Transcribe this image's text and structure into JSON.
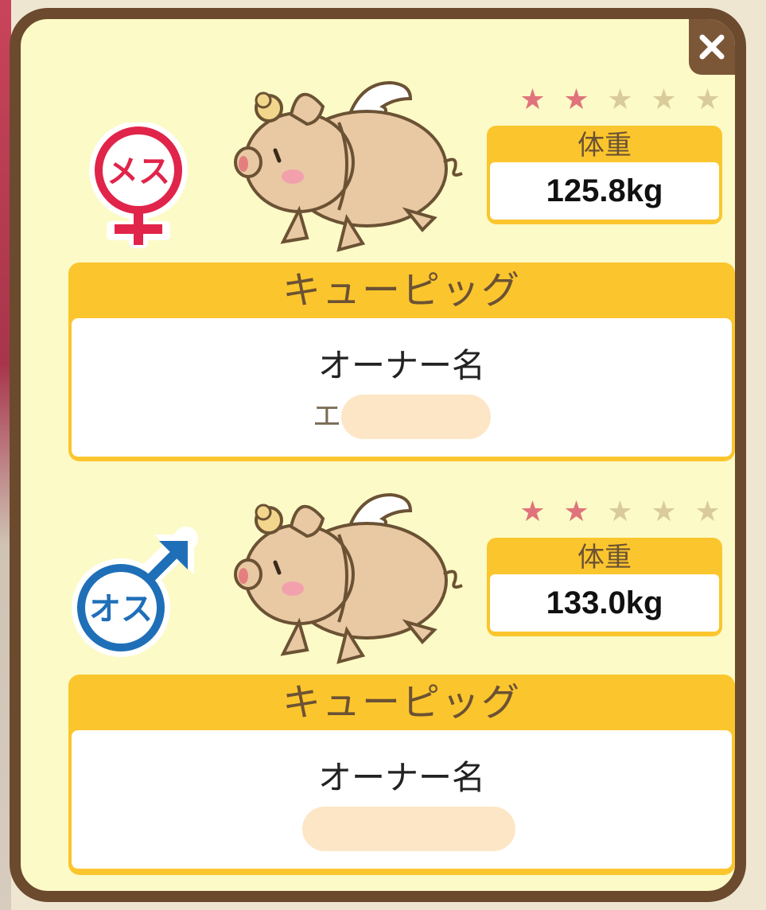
{
  "dialog": {
    "close_icon": "close-x-icon"
  },
  "pigs": [
    {
      "gender_label": "メス",
      "gender_icon": "female-symbol-icon",
      "gender_color": "#e1244a",
      "rating": 2,
      "rating_max": 5,
      "star_filled_color": "#e0737b",
      "star_empty_color": "#d9cb9a",
      "weight_label": "体重",
      "weight_value": "125.8kg",
      "breed_name": "キューピッグ",
      "owner_label": "オーナー名",
      "owner_name_visible": "エ"
    },
    {
      "gender_label": "オス",
      "gender_icon": "male-symbol-icon",
      "gender_color": "#1f6fb8",
      "rating": 2,
      "rating_max": 5,
      "star_filled_color": "#e0737b",
      "star_empty_color": "#d9cb9a",
      "weight_label": "体重",
      "weight_value": "133.0kg",
      "breed_name": "キューピッグ",
      "owner_label": "オーナー名",
      "owner_name_visible": ""
    }
  ],
  "colors": {
    "panel_bg": "#fcfac7",
    "frame": "#6b4a2e",
    "header_yellow": "#fbc52d",
    "pig_body": "#e8c9a3"
  }
}
